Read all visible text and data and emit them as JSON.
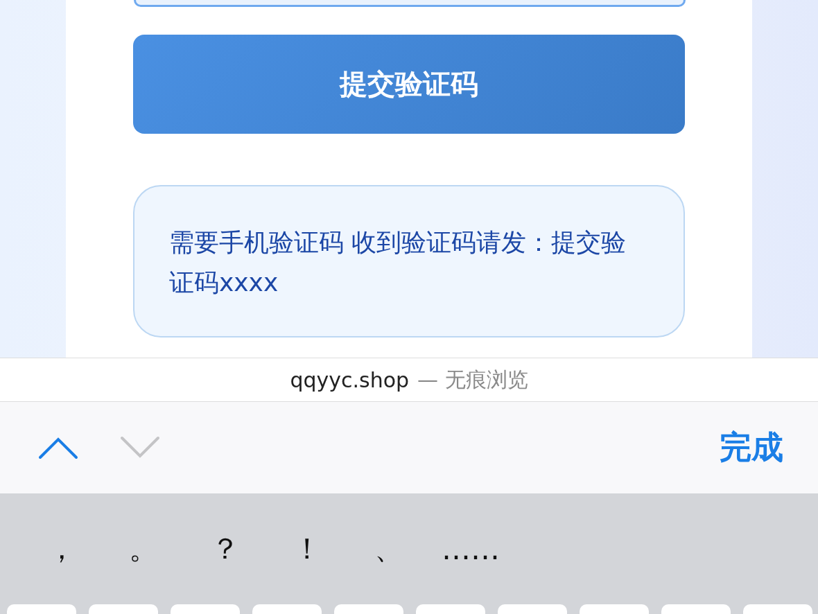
{
  "page": {
    "submit_button": "提交验证码",
    "notice": "需要手机验证码 收到验证码请发：提交验证码xxxx"
  },
  "address_bar": {
    "domain": "qqyyc.shop",
    "mode": "— 无痕浏览"
  },
  "toolbar": {
    "previous": {
      "disabled": false
    },
    "next": {
      "disabled": true
    },
    "done": "完成"
  },
  "keyboard": {
    "candidates": [
      "，",
      "。",
      "？",
      "！",
      "、",
      "……"
    ]
  }
}
